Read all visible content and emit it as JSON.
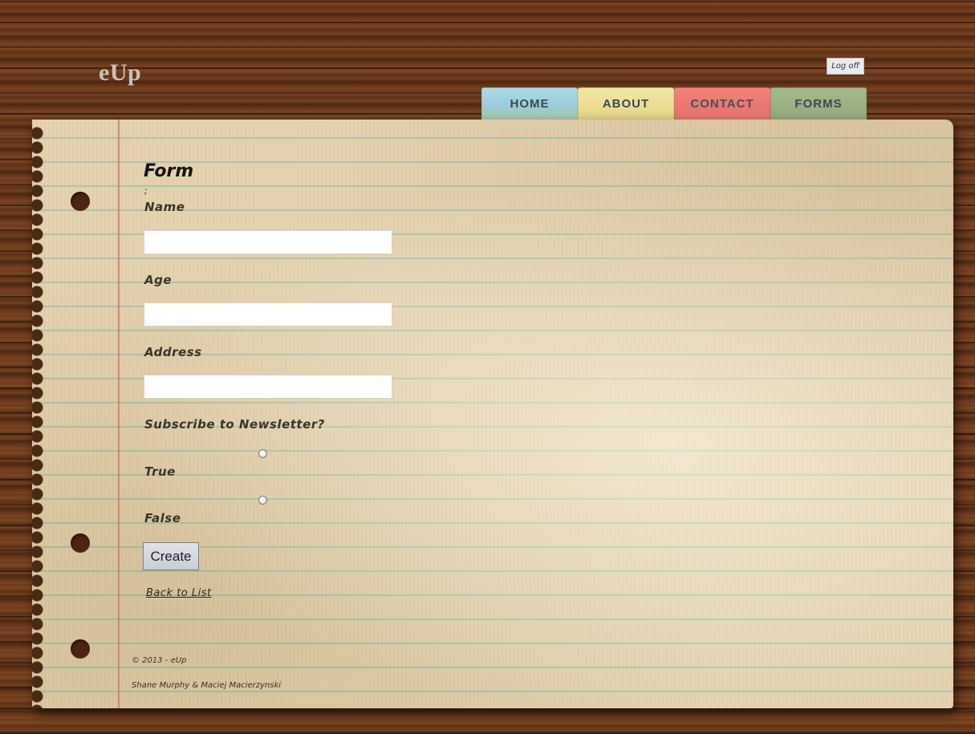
{
  "header": {
    "logo": "eUp",
    "logoff_label": "Log off"
  },
  "nav": {
    "tabs": [
      {
        "label": "HOME",
        "color": "#abdbe6"
      },
      {
        "label": "ABOUT",
        "color": "#f1e6a6"
      },
      {
        "label": "CONTACT",
        "color": "#f1837c"
      },
      {
        "label": "FORMS",
        "color": "#a2b98a"
      }
    ]
  },
  "form": {
    "title": "Form",
    "stray_text": ";",
    "fields": [
      {
        "label": "Name",
        "value": ""
      },
      {
        "label": "Age",
        "value": ""
      },
      {
        "label": "Address",
        "value": ""
      }
    ],
    "subscribe_label": "Subscribe to Newsletter?",
    "options": [
      {
        "label": "True",
        "checked": false
      },
      {
        "label": "False",
        "checked": false
      }
    ],
    "submit_label": "Create",
    "back_link": "Back to List"
  },
  "footer": {
    "copyright": "© 2013 - eUp",
    "authors": "Shane Murphy & Maciej Macierzynski"
  }
}
